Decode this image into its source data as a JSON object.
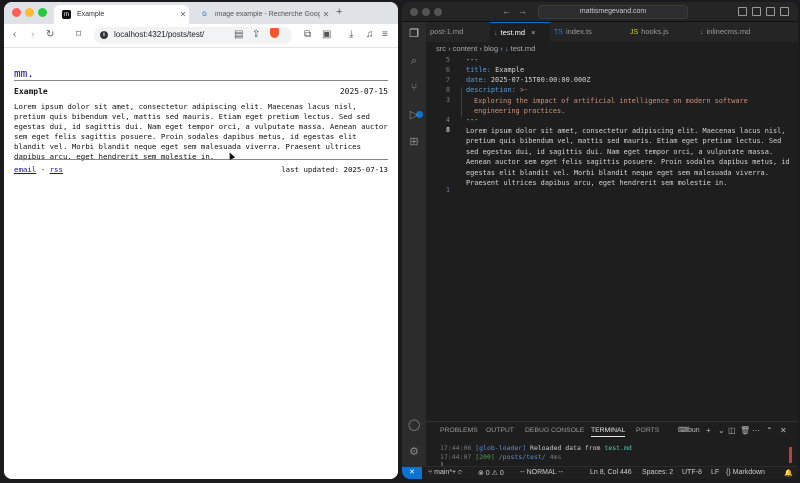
{
  "browser": {
    "tabs": [
      {
        "title": "Example",
        "favicon": "site-favicon"
      },
      {
        "title": "image example - Recherche Google",
        "favicon": "google-favicon"
      }
    ],
    "url": "localhost:4321/posts/test/",
    "page": {
      "logo": "mm.",
      "post_title": "Example",
      "post_date": "2025-07-15",
      "body": "Lorem ipsum dolor sit amet, consectetur adipiscing elit. Maecenas lacus nisl, pretium quis bibendum vel, mattis sed mauris. Etiam eget pretium lectus. Sed sed egestas dui, id sagittis dui. Nam eget tempor orci, a vulputate massa. Aenean auctor sem eget felis sagittis posuere. Proin sodales dapibus metus, id egestas elit blandit vel. Morbi blandit neque eget sem malesuada viverra. Praesent ultrices dapibus arcu, eget hendrerit sem molestie in.",
      "footer_email": "email",
      "footer_sep": "-",
      "footer_rss": "rss",
      "footer_updated": "last updated: 2025-07-13"
    }
  },
  "vscode": {
    "search": "mattismegevand.com",
    "tabs": [
      {
        "name": "post-1.md",
        "type": "md"
      },
      {
        "name": "test.md",
        "type": "md"
      },
      {
        "name": "index.ts",
        "type": "ts"
      },
      {
        "name": "hooks.js",
        "type": "js"
      },
      {
        "name": "inlinecms.md",
        "type": "md"
      }
    ],
    "active_tab": "test.md",
    "breadcrumbs": [
      "src",
      "content",
      "blog",
      "test.md"
    ],
    "lines": {
      "n1": "5",
      "n2": "6",
      "n3": "7",
      "n4": "8",
      "n5": "3",
      "n6": "4",
      "n7": "8",
      "n8": "1",
      "l1": "---",
      "l2_key": "title:",
      "l2_val": "Example",
      "l3_key": "date:",
      "l3_val": "2025-07-15T00:00:00.000Z",
      "l4_key": "description:",
      "l4_val": ">-",
      "l5": "Exploring the impact of artificial intelligence on modern software engineering practices.",
      "l6": "---",
      "l7": "Lorem ipsum dolor sit amet, consectetur adipiscing elit. Maecenas lacus nisl, pretium quis bibendum vel, mattis sed mauris. Etiam eget pretium lectus. Sed sed egestas dui, id sagittis dui. Nam eget tempor orci, a vulputate massa. Aenean auctor sem eget felis sagittis posuere. Proin sodales dapibus metus, id egestas elit blandit vel. Morbi blandit neque eget sem malesuada viverra. Praesent ultrices dapibus arcu, eget hendrerit sem molestie in."
    },
    "panel_tabs": [
      "PROBLEMS",
      "OUTPUT",
      "DEBUG CONSOLE",
      "TERMINAL",
      "PORTS"
    ],
    "terminal_shell": "bun",
    "terminal": {
      "t1_time": "17:44:06",
      "t1_tag": "[glob-loader]",
      "t1_msg": "Reloaded data from",
      "t1_file": "test.md",
      "t2_time": "17:44:07",
      "t2_code": "[200]",
      "t2_path": "/posts/test/",
      "t2_ms": "4ms"
    },
    "status": {
      "branch": "main*+",
      "problems": "⊗ 0 ⚠ 0",
      "mode": "-- NORMAL --",
      "position": "Ln 8, Col 446",
      "spaces": "Spaces: 2",
      "encoding": "UTF-8",
      "eol": "LF",
      "language": "Markdown"
    }
  }
}
